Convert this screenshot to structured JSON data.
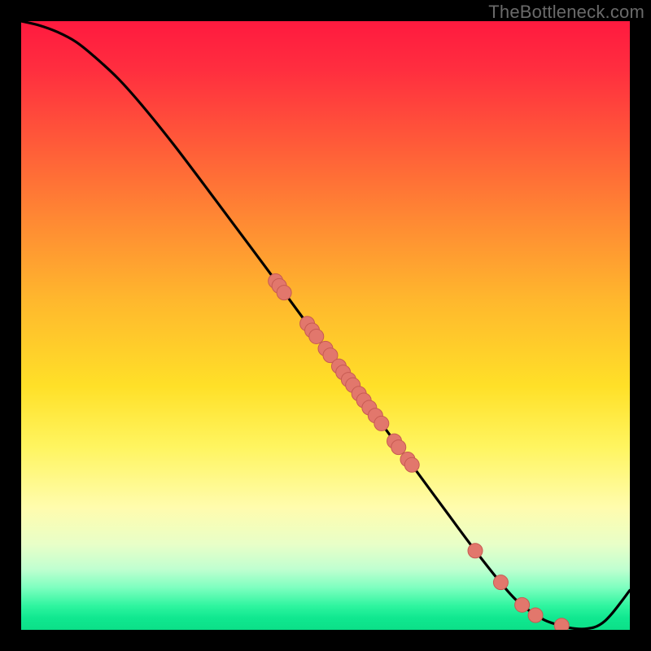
{
  "watermark": "TheBottleneck.com",
  "colors": {
    "background": "#000000",
    "curve": "#000000",
    "dot_fill": "#e2776c",
    "dot_stroke": "#c75b52"
  },
  "chart_data": {
    "type": "line",
    "title": "",
    "xlabel": "",
    "ylabel": "",
    "xlim": [
      0,
      100
    ],
    "ylim": [
      0,
      100
    ],
    "series": [
      {
        "name": "curve",
        "x": [
          0,
          3,
          6,
          9,
          12,
          16,
          20,
          25,
          30,
          35,
          40,
          45,
          50,
          55,
          60,
          65,
          70,
          75,
          80,
          83,
          86,
          89,
          91,
          93,
          95,
          97,
          100
        ],
        "y": [
          100,
          99.3,
          98.2,
          96.6,
          94.2,
          90.5,
          86,
          79.8,
          73.2,
          66.5,
          59.8,
          53,
          46.2,
          39.5,
          32.8,
          26,
          19.2,
          12.5,
          6.3,
          3.5,
          1.6,
          0.6,
          0.2,
          0.2,
          0.8,
          2.6,
          6.5
        ]
      }
    ],
    "dots": [
      {
        "x": 41.8,
        "y": 57.3
      },
      {
        "x": 42.4,
        "y": 56.5
      },
      {
        "x": 43.2,
        "y": 55.4
      },
      {
        "x": 47.0,
        "y": 50.3
      },
      {
        "x": 47.8,
        "y": 49.2
      },
      {
        "x": 48.5,
        "y": 48.2
      },
      {
        "x": 50.0,
        "y": 46.2
      },
      {
        "x": 50.8,
        "y": 45.1
      },
      {
        "x": 52.2,
        "y": 43.3
      },
      {
        "x": 52.9,
        "y": 42.3
      },
      {
        "x": 53.8,
        "y": 41.1
      },
      {
        "x": 54.5,
        "y": 40.2
      },
      {
        "x": 55.5,
        "y": 38.8
      },
      {
        "x": 56.3,
        "y": 37.7
      },
      {
        "x": 57.2,
        "y": 36.5
      },
      {
        "x": 58.2,
        "y": 35.2
      },
      {
        "x": 59.2,
        "y": 33.9
      },
      {
        "x": 61.3,
        "y": 31.0
      },
      {
        "x": 62.0,
        "y": 30.0
      },
      {
        "x": 63.5,
        "y": 28.0
      },
      {
        "x": 64.2,
        "y": 27.1
      },
      {
        "x": 74.6,
        "y": 13.0
      },
      {
        "x": 78.8,
        "y": 7.8
      },
      {
        "x": 82.3,
        "y": 4.1
      },
      {
        "x": 84.5,
        "y": 2.4
      },
      {
        "x": 88.8,
        "y": 0.7
      }
    ]
  }
}
